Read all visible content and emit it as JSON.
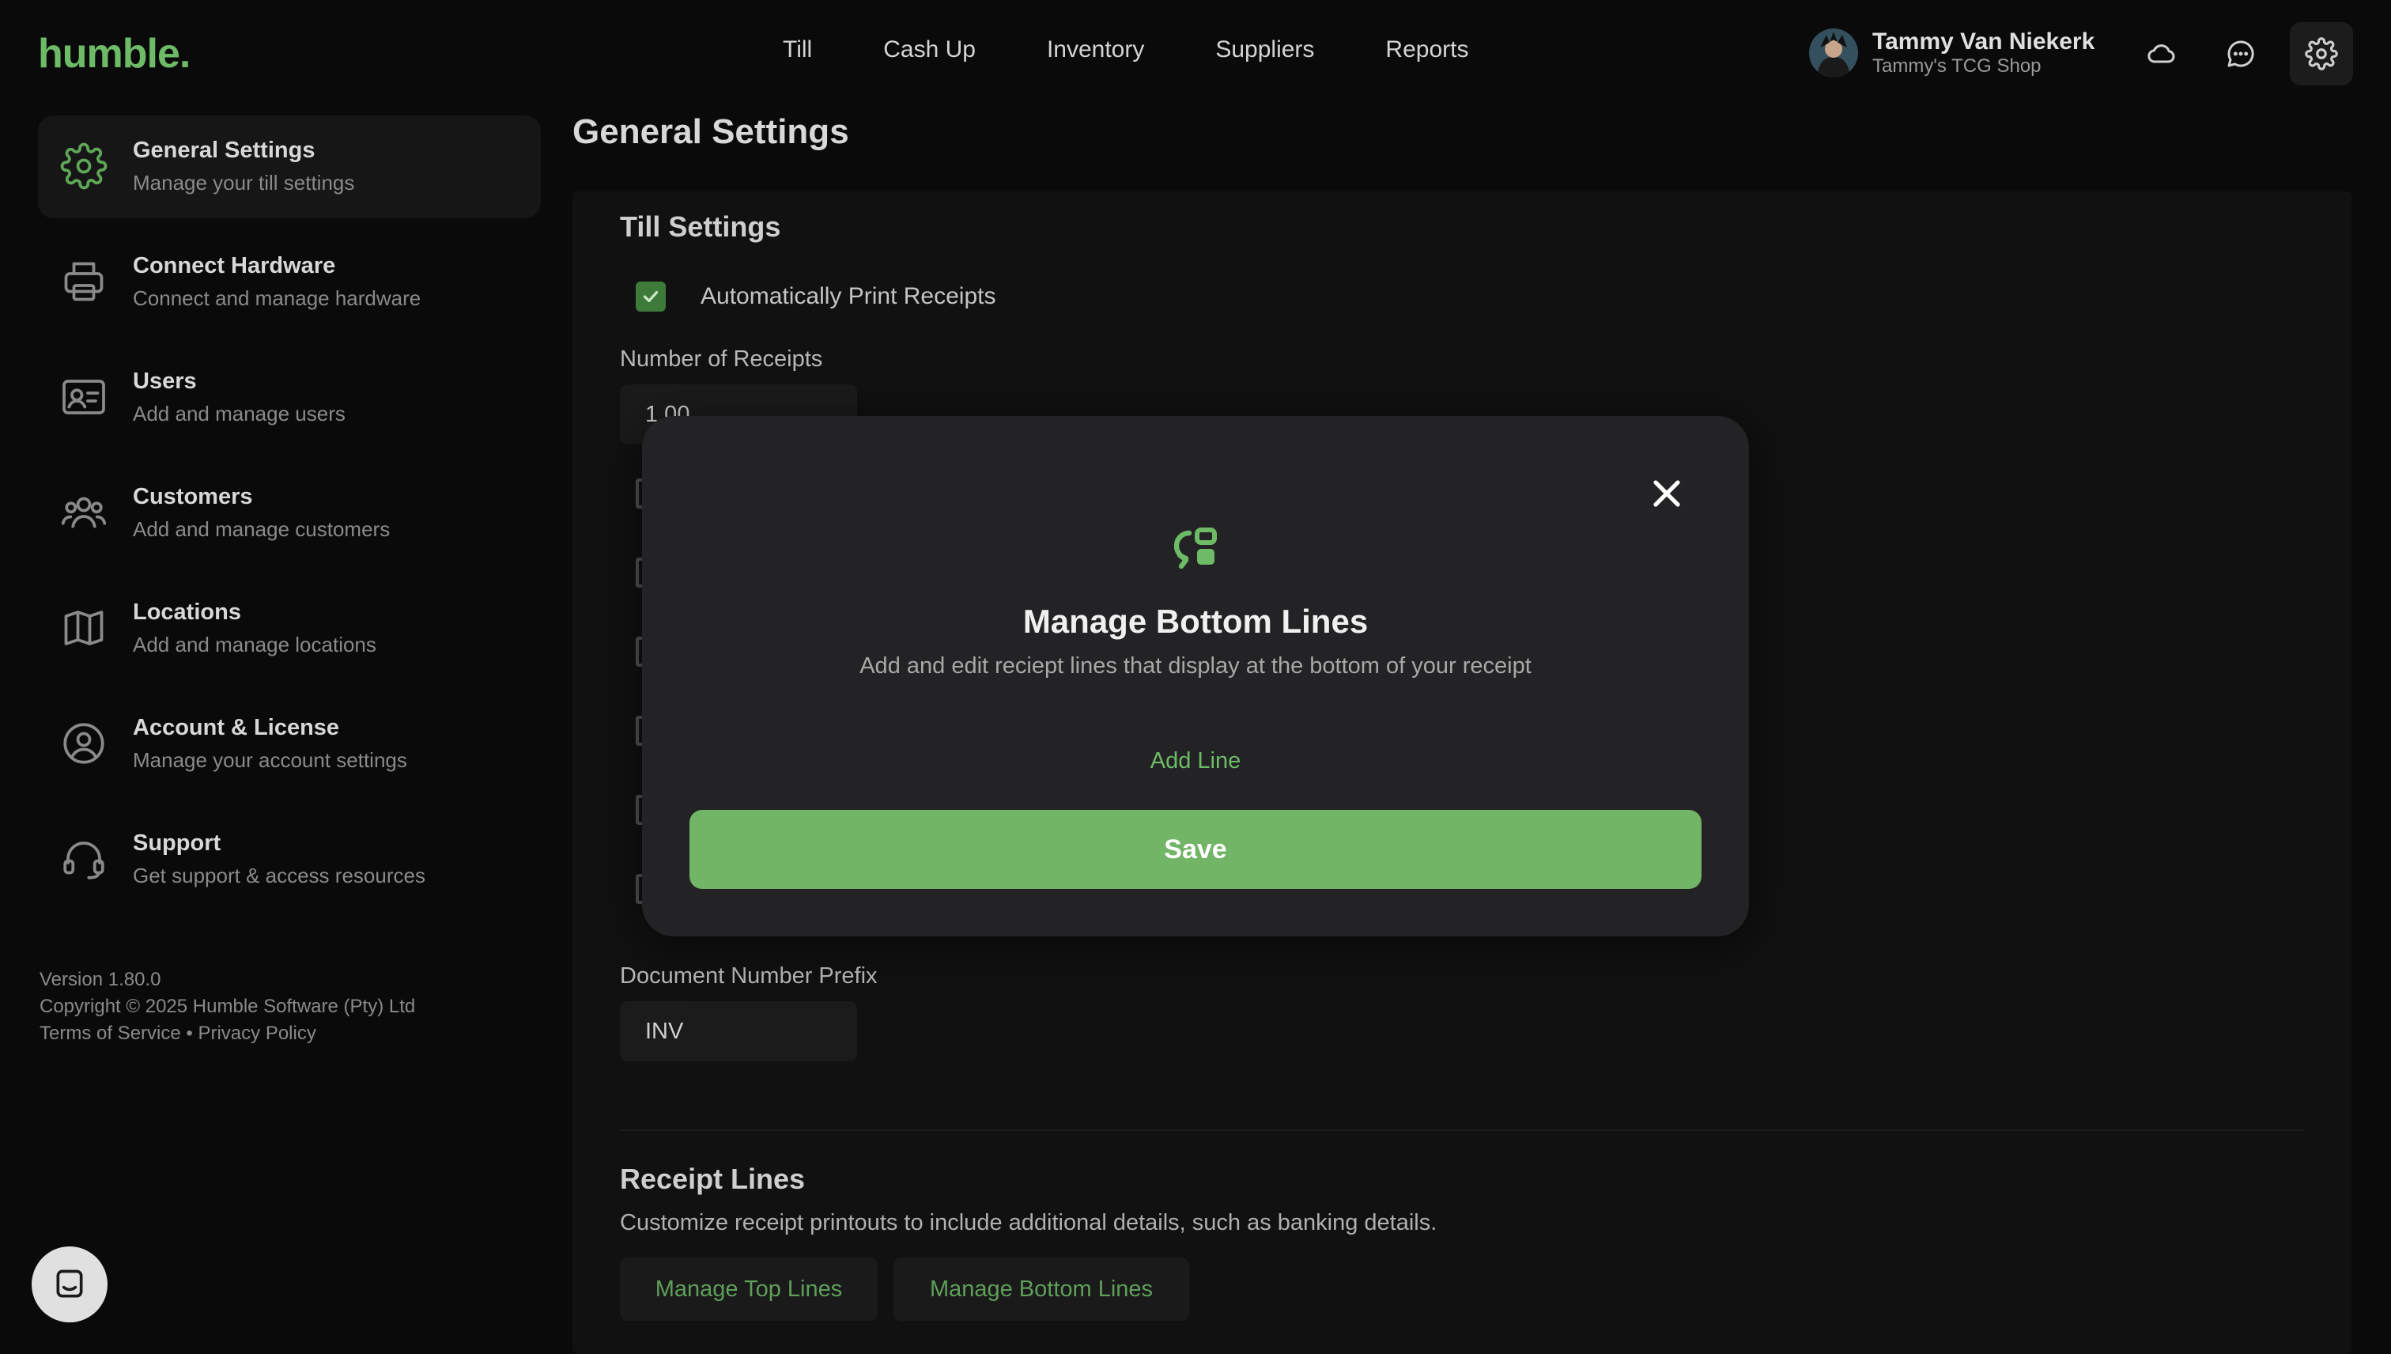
{
  "app": {
    "logo": "humble."
  },
  "nav": {
    "items": [
      "Till",
      "Cash Up",
      "Inventory",
      "Suppliers",
      "Reports"
    ]
  },
  "user": {
    "name": "Tammy Van Niekerk",
    "shop": "Tammy's TCG Shop"
  },
  "header_icons": [
    "cloud-icon",
    "chat-bubble-icon",
    "gear-icon"
  ],
  "sidebar": {
    "items": [
      {
        "title": "General Settings",
        "subtitle": "Manage your till settings",
        "icon": "gear-icon",
        "active": true
      },
      {
        "title": "Connect Hardware",
        "subtitle": "Connect and manage hardware",
        "icon": "printer-icon"
      },
      {
        "title": "Users",
        "subtitle": "Add and manage users",
        "icon": "id-card-icon"
      },
      {
        "title": "Customers",
        "subtitle": "Add and manage customers",
        "icon": "users-icon"
      },
      {
        "title": "Locations",
        "subtitle": "Add and manage locations",
        "icon": "map-icon"
      },
      {
        "title": "Account & License",
        "subtitle": "Manage your account settings",
        "icon": "user-circle-icon"
      },
      {
        "title": "Support",
        "subtitle": "Get support & access resources",
        "icon": "headset-icon"
      }
    ],
    "footer": {
      "version": "Version 1.80.0",
      "copyright": "Copyright © 2025 Humble Software (Pty) Ltd",
      "terms": "Terms of Service",
      "separator": "•",
      "privacy": "Privacy Policy"
    }
  },
  "main": {
    "title": "General Settings",
    "till_settings": {
      "title": "Till Settings",
      "auto_print_label": "Automatically Print Receipts",
      "auto_print_checked": true,
      "receipts_label": "Number of Receipts",
      "receipts_value": "1.00",
      "prefix_label": "Document Number Prefix",
      "prefix_value": "INV"
    },
    "receipt_lines": {
      "title": "Receipt Lines",
      "description": "Customize receipt printouts to include additional details, such as banking details.",
      "top_button": "Manage Top Lines",
      "bottom_button": "Manage Bottom Lines"
    }
  },
  "modal": {
    "title": "Manage Bottom Lines",
    "description": "Add and edit reciept lines that display at the bottom of your receipt",
    "add_line": "Add Line",
    "save": "Save",
    "icon": "swap-blocks-icon"
  },
  "colors": {
    "accent": "#72b566",
    "background": "#0a0a0a",
    "modal": "#232325"
  }
}
